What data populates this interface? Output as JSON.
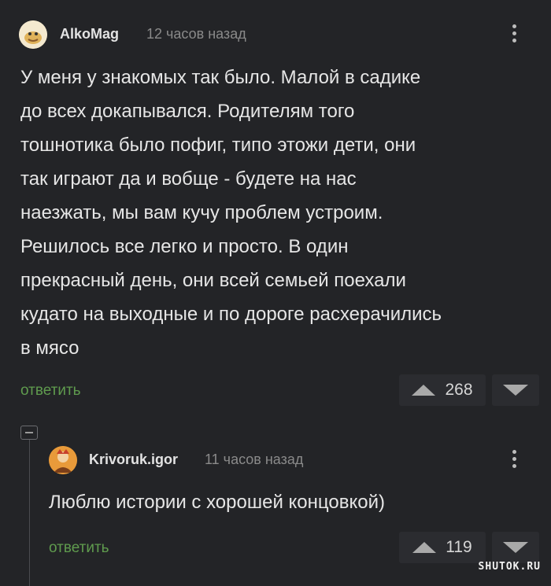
{
  "comments": [
    {
      "author": "AlkoMag",
      "time": "12 часов назад",
      "lines": [
        "У меня у знакомых так было. Малой в садике",
        "до всех докапывался. Родителям того",
        "тошнотика было пофиг, типо этожи дети, они",
        "так играют да и вобще - будете на нас",
        "наезжать, мы вам кучу проблем устроим.",
        "Решилось все легко и просто. В один",
        "прекрасный день, они всей семьей поехали",
        "кудато на выходные и по дороге расхерачились",
        "в мясо"
      ],
      "reply_label": "ответить",
      "rating": "268"
    },
    {
      "author": "Krivoruk.igor",
      "time": "11 часов назад",
      "lines": [
        "Люблю истории с хорошей концовкой)"
      ],
      "reply_label": "ответить",
      "rating": "119"
    }
  ],
  "watermark": "SHUTOK.RU",
  "colors": {
    "background": "#232427",
    "reply_link": "#5f9b4e",
    "vote_box": "#2b2c30"
  },
  "icons": [
    "avatar",
    "kebab-menu-icon",
    "upvote-icon",
    "downvote-icon",
    "collapse-thread-icon"
  ]
}
